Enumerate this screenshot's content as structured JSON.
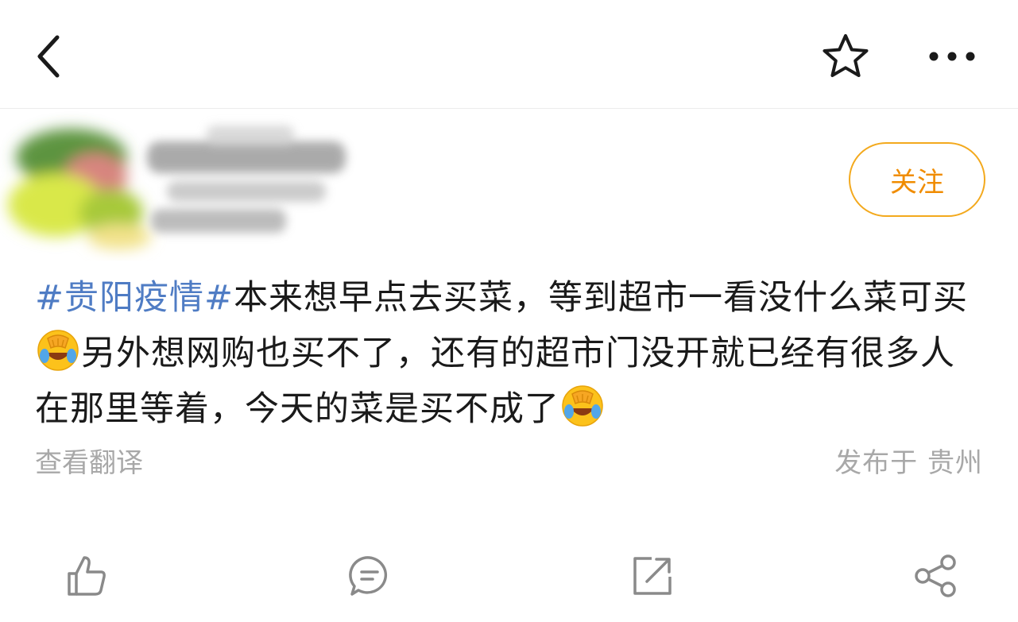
{
  "header": {
    "back_icon": "chevron-left-icon",
    "favorite_icon": "star-outline-icon",
    "more_icon": "more-dots-icon"
  },
  "author": {
    "follow_label": "关注"
  },
  "post": {
    "hashtag": "#贵阳疫情#",
    "segments": {
      "s1": "本来想早点去买菜，等到超市一看没什么菜可买",
      "s2": "另外想网购也买不了，还有的超市门没开就已经有很多人在那里等着，今天的菜是买不成了"
    },
    "emoji": "facepalm-laughing-emoji"
  },
  "meta": {
    "translate_label": "查看翻译",
    "location_label": "发布于 贵州"
  },
  "actions": {
    "like_icon": "thumbs-up-icon",
    "comment_icon": "comment-bubble-icon",
    "repost_icon": "repost-icon",
    "share_icon": "share-icon"
  },
  "colors": {
    "accent_orange": "#f08c00",
    "follow_border": "#f3a91d",
    "hashtag_blue": "#4f7cc4",
    "meta_gray": "#a8a8a8"
  }
}
